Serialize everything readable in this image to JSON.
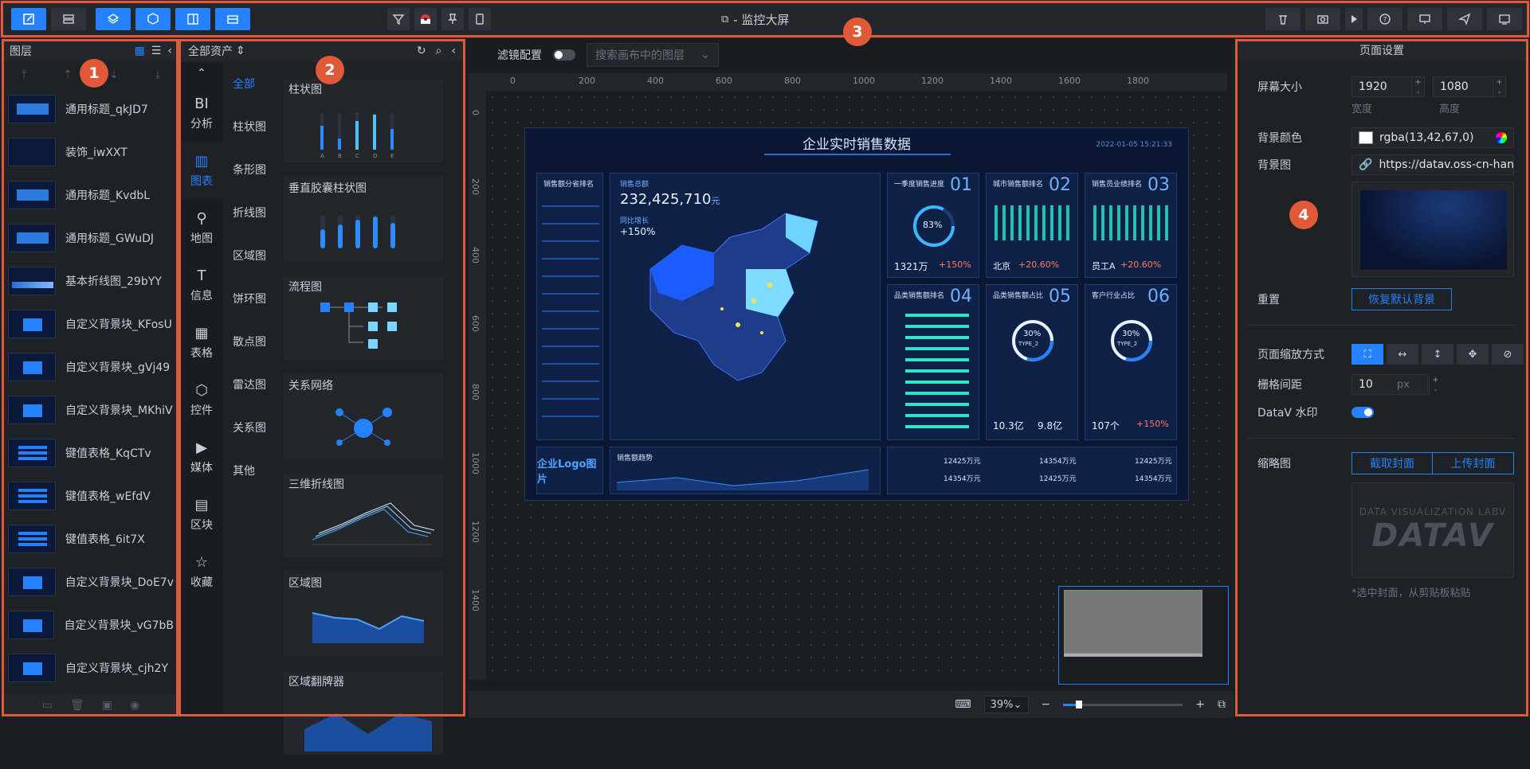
{
  "app": {
    "title": "- 监控大屏"
  },
  "badges": [
    "1",
    "2",
    "3",
    "4"
  ],
  "layers": {
    "title": "图层",
    "items": [
      {
        "name": "通用标题_qkJD7",
        "thumb": "title"
      },
      {
        "name": "装饰_iwXXT",
        "thumb": "deco"
      },
      {
        "name": "通用标题_KvdbL",
        "thumb": "title"
      },
      {
        "name": "通用标题_GWuDJ",
        "thumb": "title"
      },
      {
        "name": "基本折线图_29bYY",
        "thumb": "line"
      },
      {
        "name": "自定义背景块_KFosU",
        "thumb": "blue"
      },
      {
        "name": "自定义背景块_gVj49",
        "thumb": "blue"
      },
      {
        "name": "自定义背景块_MKhiV",
        "thumb": "blue"
      },
      {
        "name": "键值表格_KqCTv",
        "thumb": "table"
      },
      {
        "name": "键值表格_wEfdV",
        "thumb": "table"
      },
      {
        "name": "键值表格_6it7X",
        "thumb": "table"
      },
      {
        "name": "自定义背景块_DoE7v",
        "thumb": "blue"
      },
      {
        "name": "自定义背景块_vG7bB",
        "thumb": "blue"
      },
      {
        "name": "自定义背景块_cjh2Y",
        "thumb": "blue"
      }
    ]
  },
  "assets": {
    "title": "全部资产",
    "categories": [
      {
        "icon": "BI",
        "label": "分析"
      },
      {
        "icon": "▥",
        "label": "图表"
      },
      {
        "icon": "⚲",
        "label": "地图"
      },
      {
        "icon": "T",
        "label": "信息"
      },
      {
        "icon": "▦",
        "label": "表格"
      },
      {
        "icon": "⬡",
        "label": "控件"
      },
      {
        "icon": "▶",
        "label": "媒体"
      },
      {
        "icon": "▤",
        "label": "区块"
      },
      {
        "icon": "☆",
        "label": "收藏"
      }
    ],
    "subcategories": [
      "全部",
      "柱状图",
      "条形图",
      "折线图",
      "区域图",
      "饼环图",
      "散点图",
      "雷达图",
      "关系图",
      "其他"
    ],
    "cards": [
      "柱状图",
      "垂直胶囊柱状图",
      "流程图",
      "关系网络",
      "三维折线图",
      "区域图",
      "区域翻牌器"
    ]
  },
  "canvas": {
    "filter_label": "滤镜配置",
    "search_placeholder": "搜索画布中的图层",
    "ruler_h": [
      "0",
      "200",
      "400",
      "600",
      "800",
      "1000",
      "1200",
      "1400",
      "1600",
      "1800"
    ],
    "ruler_v": [
      "0",
      "200",
      "400",
      "600",
      "800",
      "1000",
      "1200",
      "1400"
    ],
    "zoom": "39%",
    "screen": {
      "title": "企业实时销售数据",
      "date": "2022-01-05 15:21:33",
      "left_panel_title": "销售额分省排名",
      "total_label": "销售总额",
      "total_value": "232,425,710",
      "total_unit": "元",
      "growth_label": "同比增长",
      "growth_value": "+150%",
      "p01_title": "一季度销售进度",
      "p01_num": "01",
      "p01_pct": "83%",
      "p01_value": "1321万",
      "p01_growth": "+150%",
      "p02_title": "城市销售额排名",
      "p02_num": "02",
      "p02_city": "北京",
      "p02_growth": "+20.60%",
      "p03_title": "销售员业绩排名",
      "p03_num": "03",
      "p03_person": "员工A",
      "p03_growth": "+20.60%",
      "p04_title": "品类销售额排名",
      "p04_num": "04",
      "p05_title": "品类销售额占比",
      "p05_num": "05",
      "p05_pct": "30%",
      "p05_type": "TYPE_2",
      "p05_v1": "10.3亿",
      "p05_v2": "9.8亿",
      "p06_title": "客户行业占比",
      "p06_num": "06",
      "p06_pct": "30%",
      "p06_type": "TYPE_2",
      "p06_v1": "107个",
      "p06_v2": "+150%",
      "logo": "企业Logo图片",
      "trend_title": "销售额趋势",
      "kv": [
        "12425万元",
        "14354万元",
        "12425万元",
        "14354万元",
        "12425万元",
        "14354万元"
      ]
    }
  },
  "settings": {
    "title": "页面设置",
    "screen_size_label": "屏幕大小",
    "width": "1920",
    "height": "1080",
    "width_label": "宽度",
    "height_label": "高度",
    "bg_color_label": "背景颜色",
    "bg_color": "rgba(13,42,67,0)",
    "bg_image_label": "背景图",
    "bg_image_url": "https://datav.oss-cn-hangzhou",
    "reset_label": "重置",
    "reset_button": "恢复默认背景",
    "zoom_mode_label": "页面缩放方式",
    "grid_label": "栅格间距",
    "grid_value": "10",
    "grid_unit": "px",
    "watermark_label": "DataV 水印",
    "thumbnail_label": "缩略图",
    "capture_button": "截取封面",
    "upload_button": "上传封面",
    "thumb_text_a": "DATA VISUALIZATION LABV",
    "thumb_text_b": "DATAV",
    "hint": "*选中封面，从剪贴板粘贴"
  },
  "colors": {
    "accent": "#2681ff",
    "annotation": "#e05a38"
  }
}
